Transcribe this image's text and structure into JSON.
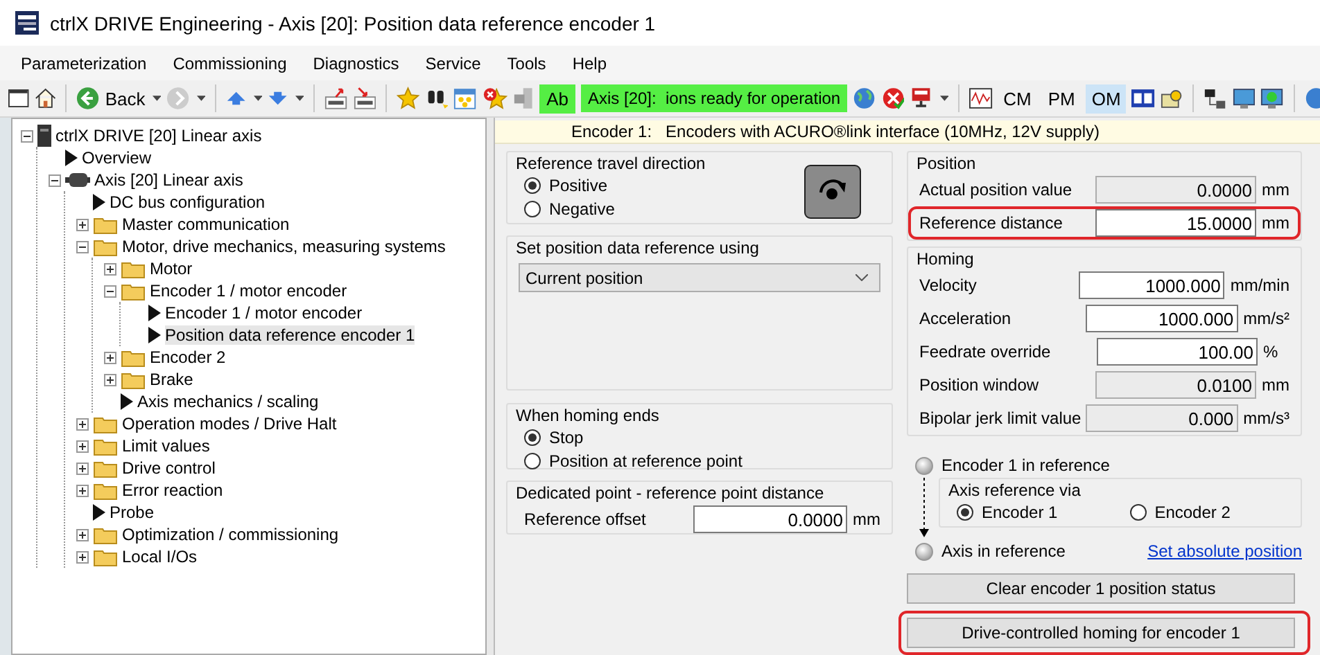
{
  "window": {
    "title": "ctrlX DRIVE Engineering - Axis [20]: Position data reference encoder 1"
  },
  "menu": [
    {
      "label": "Parameterization"
    },
    {
      "label": "Commissioning"
    },
    {
      "label": "Diagnostics"
    },
    {
      "label": "Service"
    },
    {
      "label": "Tools"
    },
    {
      "label": "Help"
    }
  ],
  "toolbar": {
    "back_label": "Back",
    "ab_label": "Ab",
    "status": "Axis [20]:  ions ready for operation",
    "modes": [
      {
        "label": "CM",
        "selected": false
      },
      {
        "label": "PM",
        "selected": false
      },
      {
        "label": "OM",
        "selected": true
      }
    ]
  },
  "tree": [
    {
      "label": "ctrlX DRIVE [20] Linear axis",
      "kind": "device",
      "expanded": true,
      "selected": false,
      "children": [
        {
          "label": "Overview",
          "kind": "page",
          "selected": false
        },
        {
          "label": "Axis [20] Linear axis",
          "kind": "axis",
          "expanded": true,
          "selected": false,
          "children": [
            {
              "label": "DC bus configuration",
              "kind": "page",
              "selected": false
            },
            {
              "label": "Master communication",
              "kind": "folder",
              "expanded": false,
              "selected": false
            },
            {
              "label": "Motor, drive mechanics, measuring systems",
              "kind": "folder",
              "expanded": true,
              "selected": false,
              "children": [
                {
                  "label": "Motor",
                  "kind": "folder",
                  "expanded": false,
                  "selected": false
                },
                {
                  "label": "Encoder 1 / motor encoder",
                  "kind": "folder",
                  "expanded": true,
                  "selected": false,
                  "children": [
                    {
                      "label": "Encoder 1 / motor encoder",
                      "kind": "page",
                      "selected": false
                    },
                    {
                      "label": "Position data reference encoder 1",
                      "kind": "page",
                      "selected": true
                    }
                  ]
                },
                {
                  "label": "Encoder 2",
                  "kind": "folder",
                  "expanded": false,
                  "selected": false
                },
                {
                  "label": "Brake",
                  "kind": "folder",
                  "expanded": false,
                  "selected": false
                },
                {
                  "label": "Axis mechanics / scaling",
                  "kind": "page",
                  "selected": false
                }
              ]
            },
            {
              "label": "Operation modes / Drive Halt",
              "kind": "folder",
              "expanded": false,
              "selected": false
            },
            {
              "label": "Limit values",
              "kind": "folder",
              "expanded": false,
              "selected": false
            },
            {
              "label": "Drive control",
              "kind": "folder",
              "expanded": false,
              "selected": false
            },
            {
              "label": "Error reaction",
              "kind": "folder",
              "expanded": false,
              "selected": false
            },
            {
              "label": "Probe",
              "kind": "page",
              "selected": false
            },
            {
              "label": "Optimization / commissioning",
              "kind": "folder",
              "expanded": false,
              "selected": false
            },
            {
              "label": "Local I/Os",
              "kind": "folder",
              "expanded": false,
              "selected": false
            }
          ]
        }
      ]
    }
  ],
  "header": "Encoder 1:   Encoders with ACURO®link interface (10MHz, 12V supply)",
  "direction": {
    "title": "Reference travel direction",
    "options": [
      {
        "label": "Positive",
        "selected": true
      },
      {
        "label": "Negative",
        "selected": false
      }
    ]
  },
  "reference_using": {
    "title": "Set position data reference using",
    "value": "Current position"
  },
  "homing_end": {
    "title": "When homing ends",
    "options": [
      {
        "label": "Stop",
        "selected": true
      },
      {
        "label": "Position at reference point",
        "selected": false
      }
    ]
  },
  "dedicated_point": {
    "title": "Dedicated point - reference point distance",
    "fields": [
      {
        "label": "Reference offset",
        "value": "0.0000",
        "unit": "mm",
        "readonly": false,
        "highlighted": false
      }
    ]
  },
  "position": {
    "title": "Position",
    "fields": [
      {
        "label": "Actual position value",
        "value": "0.0000",
        "unit": "mm",
        "readonly": true,
        "highlighted": false
      },
      {
        "label": "Reference distance",
        "value": "15.0000",
        "unit": "mm",
        "readonly": false,
        "highlighted": true
      }
    ]
  },
  "homing": {
    "title": "Homing",
    "fields": [
      {
        "label": "Velocity",
        "value": "1000.000",
        "unit": "mm/min",
        "readonly": false,
        "highlighted": false
      },
      {
        "label": "Acceleration",
        "value": "1000.000",
        "unit": "mm/s²",
        "readonly": false,
        "highlighted": false
      },
      {
        "label": "Feedrate override",
        "value": "100.00",
        "unit": "%",
        "readonly": false,
        "highlighted": false
      },
      {
        "label": "Position window",
        "value": "0.0100",
        "unit": "mm",
        "readonly": true,
        "highlighted": false
      },
      {
        "label": "Bipolar jerk limit value",
        "value": "0.000",
        "unit": "mm/s³",
        "readonly": true,
        "highlighted": false
      }
    ]
  },
  "reference_status": {
    "encoder_led": {
      "label": "Encoder 1 in reference",
      "on": false
    },
    "axis_ref": {
      "title": "Axis reference via",
      "options": [
        {
          "label": "Encoder 1",
          "selected": true
        },
        {
          "label": "Encoder 2",
          "selected": false
        }
      ]
    },
    "axis_led": {
      "label": "Axis in reference",
      "on": false
    },
    "link": "Set absolute position"
  },
  "buttons": [
    {
      "label": "Clear encoder 1 position status",
      "highlighted": false
    },
    {
      "label": "Drive-controlled homing for encoder 1",
      "highlighted": true
    }
  ]
}
